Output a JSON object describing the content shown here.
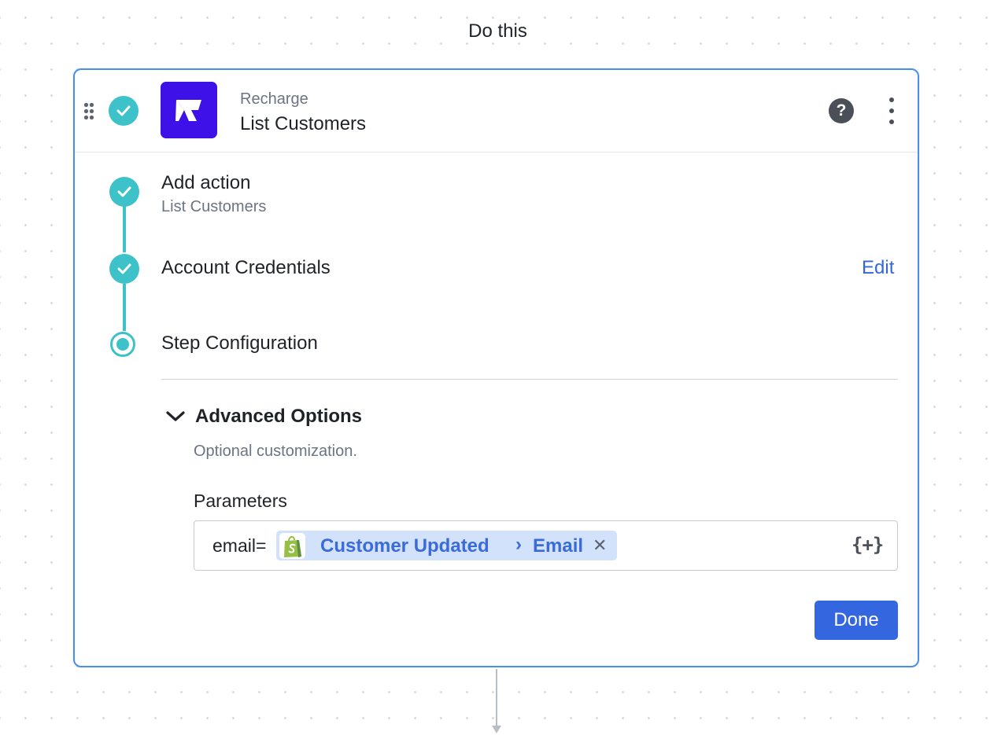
{
  "section_title": "Do this",
  "step": {
    "app_name": "Recharge",
    "action_name": "List Customers"
  },
  "progress": {
    "add_action": {
      "title": "Add action",
      "subtitle": "List Customers"
    },
    "account_credentials": {
      "title": "Account Credentials",
      "edit_label": "Edit"
    },
    "step_configuration": {
      "title": "Step Configuration"
    }
  },
  "advanced_options": {
    "title": "Advanced Options",
    "description": "Optional customization.",
    "parameters_label": "Parameters",
    "parameter_prefix": "email=",
    "pill": {
      "step_name": "Customer Updated",
      "separator": "›",
      "field_name": "Email",
      "remove_glyph": "✕"
    },
    "insert_data_glyph": "{+}"
  },
  "done_label": "Done",
  "colors": {
    "accent": "#3466e0",
    "teal": "#3cc2c8",
    "recharge_brand": "#3d11e8",
    "shopify_green": "#95bf47",
    "card_border": "#4a8fea",
    "pill_background": "#d3e2fb"
  },
  "icons": {
    "drag": "drag-handle-icon",
    "completed": "check-circle-icon",
    "current": "current-step-icon",
    "help": "help-icon",
    "more": "more-vertical-icon",
    "expand": "chevron-down-icon",
    "data_source": "shopify-bag-icon",
    "remove": "close-icon",
    "insert": "insert-data-icon"
  }
}
